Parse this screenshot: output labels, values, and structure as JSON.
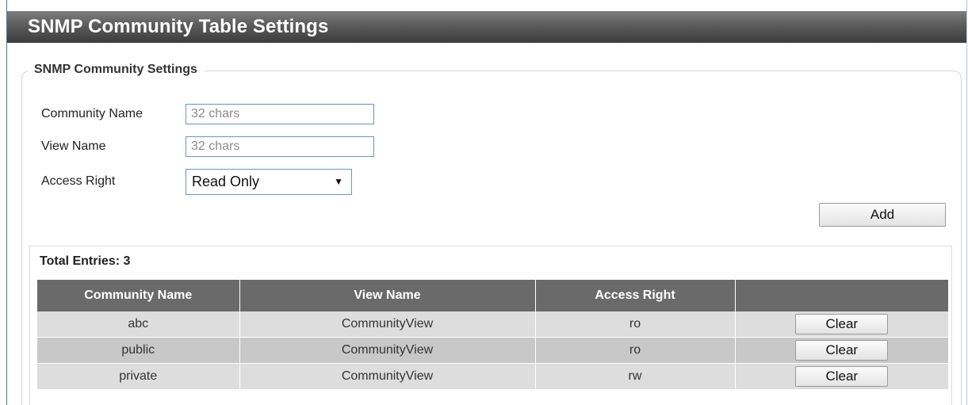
{
  "page": {
    "title": "SNMP Community Table Settings"
  },
  "form": {
    "legend": "SNMP Community Settings",
    "community_name": {
      "label": "Community Name",
      "value": "",
      "placeholder": "32 chars"
    },
    "view_name": {
      "label": "View Name",
      "value": "",
      "placeholder": "32 chars"
    },
    "access_right": {
      "label": "Access Right",
      "selected": "Read Only",
      "arrow_icon": "triangle-down-icon"
    },
    "add_button_label": "Add"
  },
  "table": {
    "total_entries": "Total Entries: 3",
    "headers": [
      "Community Name",
      "View Name",
      "Access Right",
      ""
    ],
    "rows": [
      {
        "community": "abc",
        "view": "CommunityView",
        "access": "ro",
        "action": "Clear"
      },
      {
        "community": "public",
        "view": "CommunityView",
        "access": "ro",
        "action": "Clear"
      },
      {
        "community": "private",
        "view": "CommunityView",
        "access": "rw",
        "action": "Clear"
      }
    ]
  },
  "colors": {
    "title_bar": "#5b5b5b",
    "table_header": "#6a6a6a",
    "row_light": "#dddddd",
    "row_dark": "#c8c8c8",
    "input_border": "#6b94c6"
  }
}
